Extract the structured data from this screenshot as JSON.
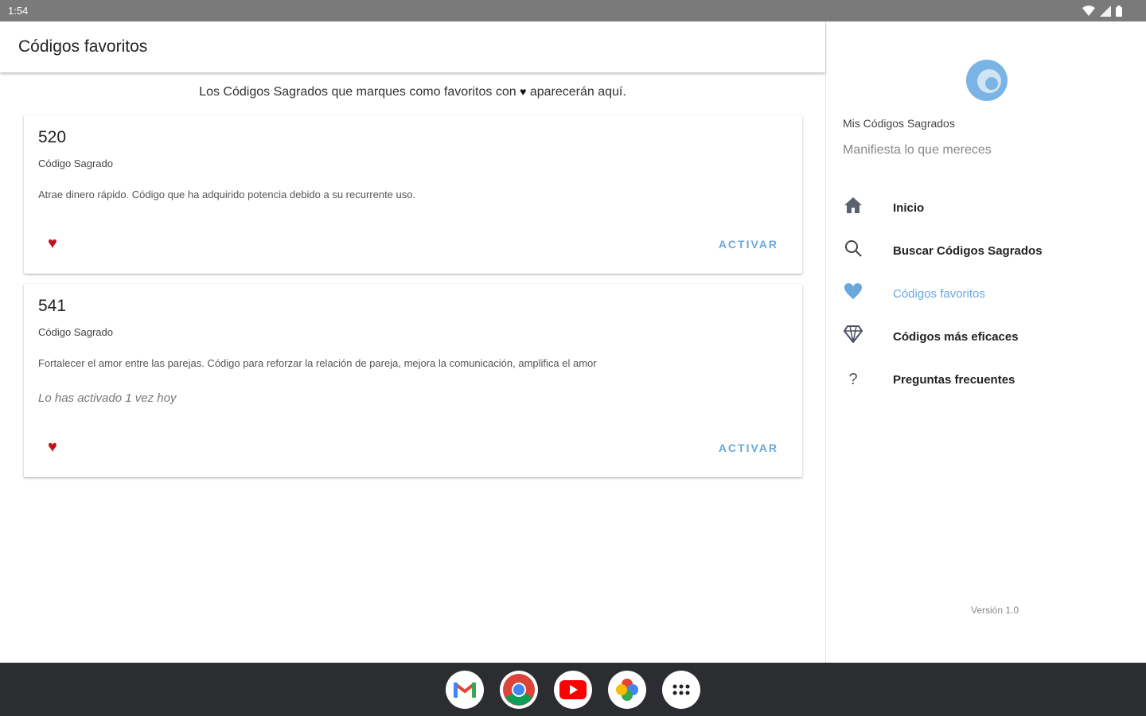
{
  "status_bar": {
    "time": "1:54"
  },
  "appbar": {
    "title": "Códigos favoritos"
  },
  "hint": {
    "before": "Los Códigos Sagrados que marques como favoritos con",
    "heart": "♥",
    "after": "aparecerán aquí."
  },
  "cards": [
    {
      "code": "520",
      "type": "Código Sagrado",
      "description": "Atrae dinero rápido. Código que ha adquirido potencia debido a su recurrente uso.",
      "activated_text": "",
      "activate_label": "ACTIVAR",
      "favorite_icon": "heart-filled-icon"
    },
    {
      "code": "541",
      "type": "Código Sagrado",
      "description": "Fortalecer el amor entre las parejas. Código para reforzar la relación de pareja, mejora la comunicación, amplifica el amor",
      "activated_text": "Lo has activado 1 vez hoy",
      "activate_label": "ACTIVAR",
      "favorite_icon": "heart-filled-icon"
    }
  ],
  "drawer": {
    "app_name": "Mis Códigos Sagrados",
    "tagline": "Manifiesta lo que mereces",
    "items": [
      {
        "label": "Inicio",
        "icon": "home-icon",
        "active": false
      },
      {
        "label": "Buscar Códigos Sagrados",
        "icon": "search-icon",
        "active": false
      },
      {
        "label": "Códigos favoritos",
        "icon": "heart-icon",
        "active": true
      },
      {
        "label": "Códigos más eficaces",
        "icon": "diamond-icon",
        "active": false
      },
      {
        "label": "Preguntas frecuentes",
        "icon": "question-icon",
        "active": false
      }
    ],
    "version": "Versión 1.0"
  },
  "colors": {
    "accent": "#6aa8dc",
    "heart_red": "#c4121c",
    "status_bar": "#7a7a7a",
    "taskbar": "#2b2d31"
  },
  "taskbar": {
    "apps": [
      "gmail-icon",
      "chrome-icon",
      "youtube-icon",
      "photos-icon",
      "app-launcher-icon"
    ]
  }
}
